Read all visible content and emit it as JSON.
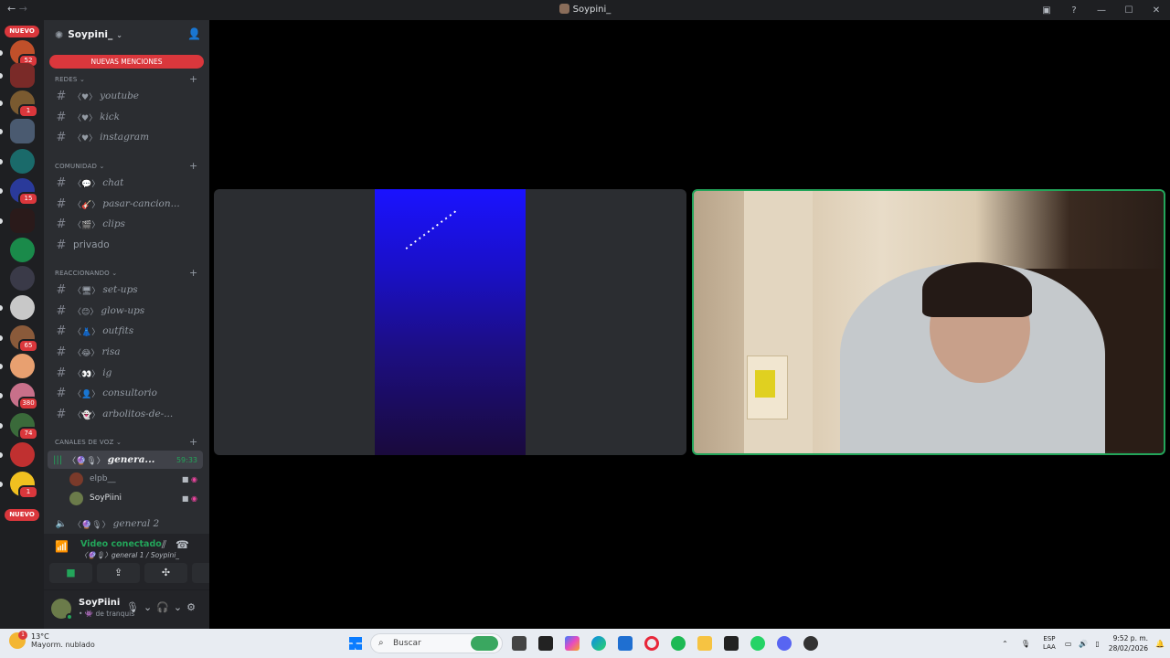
{
  "window": {
    "title": "Soypini_",
    "back": "←",
    "forward": "→"
  },
  "servers": {
    "top_label": "NUEVO",
    "bottom_label": "NUEVO",
    "items": [
      {
        "badge": "52",
        "color": "#c0502a"
      },
      {
        "badge": "",
        "color": "#7a2a28"
      },
      {
        "badge": "1",
        "color": "#7a5a30"
      },
      {
        "badge": "",
        "color": "#4a5a70"
      },
      {
        "badge": "",
        "color": "#1a6a6a"
      },
      {
        "badge": "15",
        "color": "#2a3a9a"
      },
      {
        "badge": "",
        "color": "#2a1a1a"
      },
      {
        "badge": "",
        "color": "#1a8a4a"
      },
      {
        "badge": "",
        "color": "#3a3a48"
      },
      {
        "badge": "",
        "color": "#c8c8c8"
      },
      {
        "badge": "65",
        "color": "#8a5a3a"
      },
      {
        "badge": "",
        "color": "#e8a070"
      },
      {
        "badge": "380",
        "color": "#c8708a"
      },
      {
        "badge": "74",
        "color": "#3a6a3a"
      },
      {
        "badge": "",
        "color": "#c03030"
      },
      {
        "badge": "1",
        "color": "#f0c020"
      }
    ]
  },
  "guild": {
    "name": "Soypini_"
  },
  "mentions_label": "NUEVAS MENCIONES",
  "categories": {
    "redes": "REDES",
    "comunidad": "COMUNIDAD",
    "reaccionando": "REACCIONANDO",
    "voz": "CANALES DE VOZ"
  },
  "channels": {
    "youtube": {
      "deco": "〈♥〉",
      "name": "youtube"
    },
    "kick": {
      "deco": "〈♥〉",
      "name": "kick"
    },
    "instagram": {
      "deco": "〈♥〉",
      "name": "instagram"
    },
    "chat": {
      "deco": "〈💬〉",
      "name": "chat"
    },
    "pasar": {
      "deco": "〈🎸〉",
      "name": "pasar-cancion..."
    },
    "clips": {
      "deco": "〈🎬〉",
      "name": "clips"
    },
    "privado": {
      "name": "privado"
    },
    "setups": {
      "deco": "〈🖥〉",
      "name": "set-ups"
    },
    "glowups": {
      "deco": "〈😊〉",
      "name": "glow-ups"
    },
    "outfits": {
      "deco": "〈👗〉",
      "name": "outfits"
    },
    "risa": {
      "deco": "〈😂〉",
      "name": "risa"
    },
    "ig": {
      "deco": "〈👀〉",
      "name": "ig"
    },
    "consultorio": {
      "deco": "〈👤〉",
      "name": "consultorio"
    },
    "arbolitos": {
      "deco": "〈👻〉",
      "name": "arbolitos-de-..."
    }
  },
  "voice": {
    "active": {
      "deco": "〈🔮🎙〉",
      "name": "genera...",
      "time": "59:33"
    },
    "users": [
      {
        "name": "elpb__"
      },
      {
        "name": "SoyPiini"
      }
    ],
    "other": {
      "deco": "〈🔮🎙〉",
      "name": "general 2"
    }
  },
  "voice_panel": {
    "status": "Video conectado",
    "channel": "〈🔮🎙〉general 1 / Soypini_"
  },
  "user_panel": {
    "name": "SoyPiini",
    "status": "• 👾 de tranquis"
  },
  "taskbar": {
    "temp": "13°C",
    "weather": "Mayorm. nublado",
    "alert": "1",
    "search_placeholder": "Buscar",
    "lang1": "ESP",
    "lang2": "LAA",
    "time": "9:52 p. m.",
    "date": "28/02/2026"
  }
}
